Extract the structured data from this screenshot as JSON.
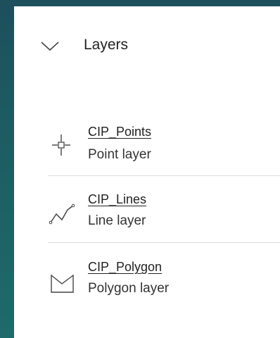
{
  "panel": {
    "title": "Layers",
    "collapse_icon": "chevron-down-icon"
  },
  "layers": [
    {
      "name": "CIP_Points",
      "type": "Point layer",
      "icon": "point-layer-icon"
    },
    {
      "name": "CIP_Lines",
      "type": "Line layer",
      "icon": "line-layer-icon"
    },
    {
      "name": "CIP_Polygon",
      "type": "Polygon layer",
      "icon": "polygon-layer-icon"
    }
  ]
}
